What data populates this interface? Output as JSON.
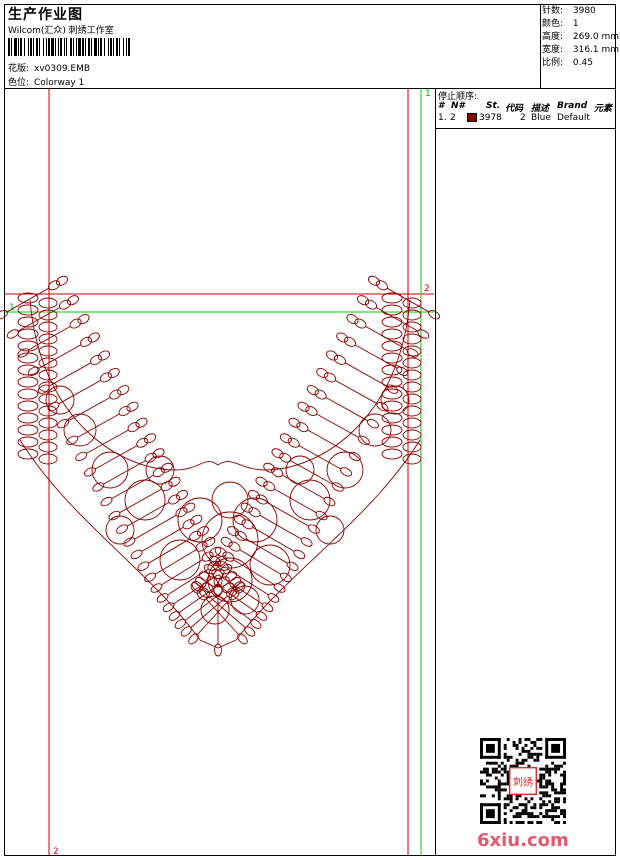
{
  "header": {
    "title": "生产作业图",
    "company": "Wilcom(汇众) 刺绣工作室",
    "design_label": "花版:",
    "design_value": "xv0309.EMB",
    "colorway_label": "色位:",
    "colorway_value": "Colorway 1"
  },
  "stats": [
    {
      "label": "针数:",
      "value": "3980"
    },
    {
      "label": "颜色:",
      "value": "1"
    },
    {
      "label": "高度:",
      "value": "269.0 mm"
    },
    {
      "label": "宽度:",
      "value": "316.1 mm"
    },
    {
      "label": "比例:",
      "value": "0.45"
    }
  ],
  "stop_sequence": {
    "title": "停止顺序:",
    "columns": [
      "#",
      "N#",
      "St.",
      "代码",
      "描述",
      "Brand",
      "元素"
    ],
    "rows": [
      {
        "index": "1.",
        "needle": "2",
        "color": "#8B0000",
        "stitches": "3978",
        "code": "2",
        "description": "Blue",
        "brand": "Default",
        "element": ""
      }
    ]
  },
  "guides": {
    "label_top_right": "1",
    "label_mid_right": "2",
    "label_left": "1",
    "label_bottom": "2",
    "green_color": "#00cc00",
    "red_color": "#cc0000"
  },
  "design_color": "#8B0000",
  "watermark": "6xiu.com",
  "qr_stamp_text": "刺绣"
}
